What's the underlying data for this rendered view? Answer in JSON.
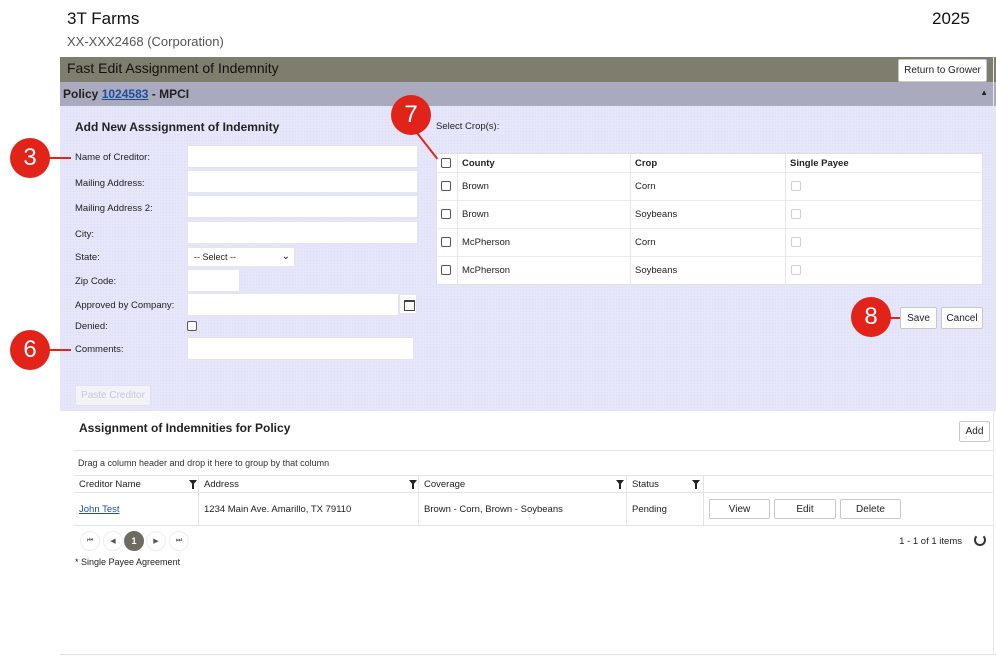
{
  "header": {
    "farm_name": "3T Farms",
    "farm_id": "XX-XXX2468 (Corporation)",
    "year": "2025"
  },
  "title_bar": {
    "title": "Fast Edit Assignment of Indemnity",
    "return_label": "Return to Grower"
  },
  "policy_bar": {
    "prefix": "Policy",
    "policy_number": "1024583",
    "suffix": "- MPCI"
  },
  "form": {
    "section_title": "Add New Asssignment of Indemnity",
    "labels": {
      "name_of_creditor": "Name of Creditor:",
      "mailing_address": "Mailing Address:",
      "mailing_address_2": "Mailing Address 2:",
      "city": "City:",
      "state": "State:",
      "zip": "Zip Code:",
      "approved": "Approved by Company:",
      "denied": "Denied:",
      "comments": "Comments:"
    },
    "state_value": "-- Select --",
    "paste_label": "Paste Creditor"
  },
  "crops": {
    "title": "Select Crop(s):",
    "columns": [
      "County",
      "Crop",
      "Single Payee"
    ],
    "rows": [
      {
        "county": "Brown",
        "crop": "Corn"
      },
      {
        "county": "Brown",
        "crop": "Soybeans"
      },
      {
        "county": "McPherson",
        "crop": "Corn"
      },
      {
        "county": "McPherson",
        "crop": "Soybeans"
      }
    ],
    "save_label": "Save",
    "cancel_label": "Cancel"
  },
  "grid": {
    "title": "Assignment of Indemnities for Policy",
    "add_label": "Add",
    "group_hint": "Drag a column header and drop it here to group by that column",
    "columns": [
      "Creditor Name",
      "Address",
      "Coverage",
      "Status"
    ],
    "rows": [
      {
        "creditor": "John Test",
        "address": "1234 Main Ave. Amarillo, TX 79110",
        "coverage": "Brown - Corn, Brown - Soybeans",
        "status": "Pending",
        "view_label": "View",
        "edit_label": "Edit",
        "delete_label": "Delete"
      }
    ],
    "pager": {
      "current_page": "1",
      "items_info": "1 - 1 of 1 items"
    },
    "footnote": "* Single Payee Agreement"
  },
  "annotations": [
    {
      "number": "3"
    },
    {
      "number": "6"
    },
    {
      "number": "7"
    },
    {
      "number": "8"
    }
  ],
  "colors": {
    "accent_red": "#e2231a",
    "title_bar": "#7f7d6e",
    "policy_bar": "#a9aabe",
    "panel": "#e6e6fa",
    "link": "#1a4f9c"
  },
  "icons": {
    "filter": "filter-icon",
    "calendar": "calendar-icon",
    "refresh": "refresh-icon",
    "collapse": "collapse-arrow-icon"
  }
}
